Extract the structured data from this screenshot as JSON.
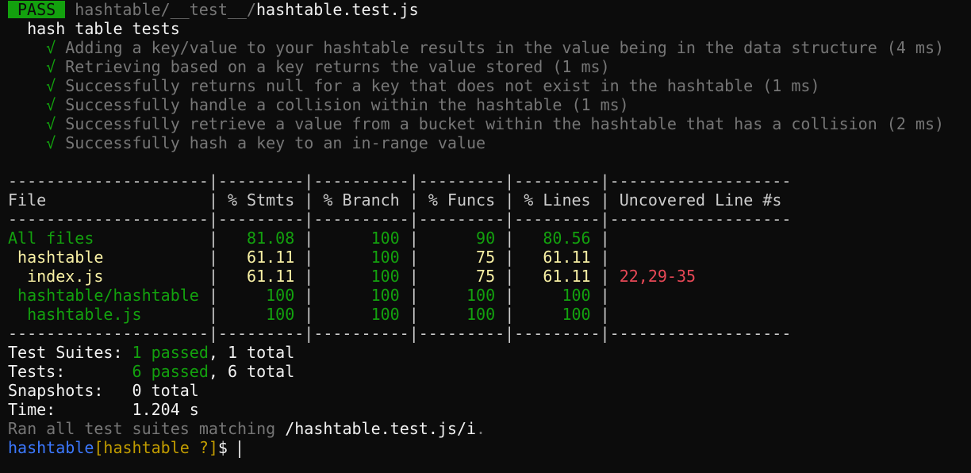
{
  "header": {
    "badge": "PASS",
    "path_dim": "hashtable/__test__/",
    "path_file": "hashtable.test.js"
  },
  "suite": {
    "name": "hash table tests",
    "check": "√",
    "tests": [
      "Adding a key/value to your hashtable results in the value being in the data structure (4 ms)",
      "Retrieving based on a key returns the value stored (1 ms)",
      "Successfully returns null for a key that does not exist in the hashtable (1 ms)",
      "Successfully handle a collision within the hashtable (1 ms)",
      "Successfully retrieve a value from a bucket within the hashtable that has a collision (2 ms)",
      "Successfully hash a key to an in-range value"
    ]
  },
  "coverage": {
    "separator": "---------------------|---------|----------|---------|---------|-------------------",
    "header": {
      "file": "File                 ",
      "stmts": " % Stmts ",
      "branch": " % Branch ",
      "funcs": " % Funcs ",
      "lines": " % Lines ",
      "uncovered": " Uncovered Line #s "
    },
    "rows": [
      {
        "file": "All files            ",
        "stmts": "   81.08 ",
        "branch": "      100 ",
        "funcs": "      90 ",
        "lines": "   80.56 ",
        "uncovered": "                   ",
        "color": "green"
      },
      {
        "file": " hashtable           ",
        "stmts": "   61.11 ",
        "branch": "      100 ",
        "funcs": "      75 ",
        "lines": "   61.11 ",
        "uncovered": "                   ",
        "color": "yellow"
      },
      {
        "file": "  index.js           ",
        "stmts": "   61.11 ",
        "branch": "      100 ",
        "funcs": "      75 ",
        "lines": "   61.11 ",
        "uncovered": " 22,29-35          ",
        "color": "yellow"
      },
      {
        "file": " hashtable/hashtable ",
        "stmts": "     100 ",
        "branch": "      100 ",
        "funcs": "     100 ",
        "lines": "     100 ",
        "uncovered": "                   ",
        "color": "green"
      },
      {
        "file": "  hashtable.js       ",
        "stmts": "     100 ",
        "branch": "      100 ",
        "funcs": "     100 ",
        "lines": "     100 ",
        "uncovered": "                   ",
        "color": "green"
      }
    ]
  },
  "summary": {
    "suites_label": "Test Suites: ",
    "suites_passed": "1 passed",
    "suites_total": ", 1 total",
    "tests_label": "Tests:       ",
    "tests_passed": "6 passed",
    "tests_total": ", 6 total",
    "snapshots_label": "Snapshots:   ",
    "snapshots_value": "0 total",
    "time_label": "Time:        ",
    "time_value": "1.204 s",
    "ran_prefix": "Ran all test suites matching ",
    "ran_pattern": "/hashtable.test.js/i",
    "ran_suffix": "."
  },
  "prompt": {
    "user": "hashtable",
    "bracket": "[hashtable ?]",
    "symbol": "$ "
  },
  "colors": {
    "background": "#0c0c0c",
    "pass_green": "#13a10e",
    "yellow": "#f9f1a5",
    "red": "#e74856",
    "blue": "#3b78ff",
    "gold": "#c19c00",
    "dim": "#767676"
  }
}
